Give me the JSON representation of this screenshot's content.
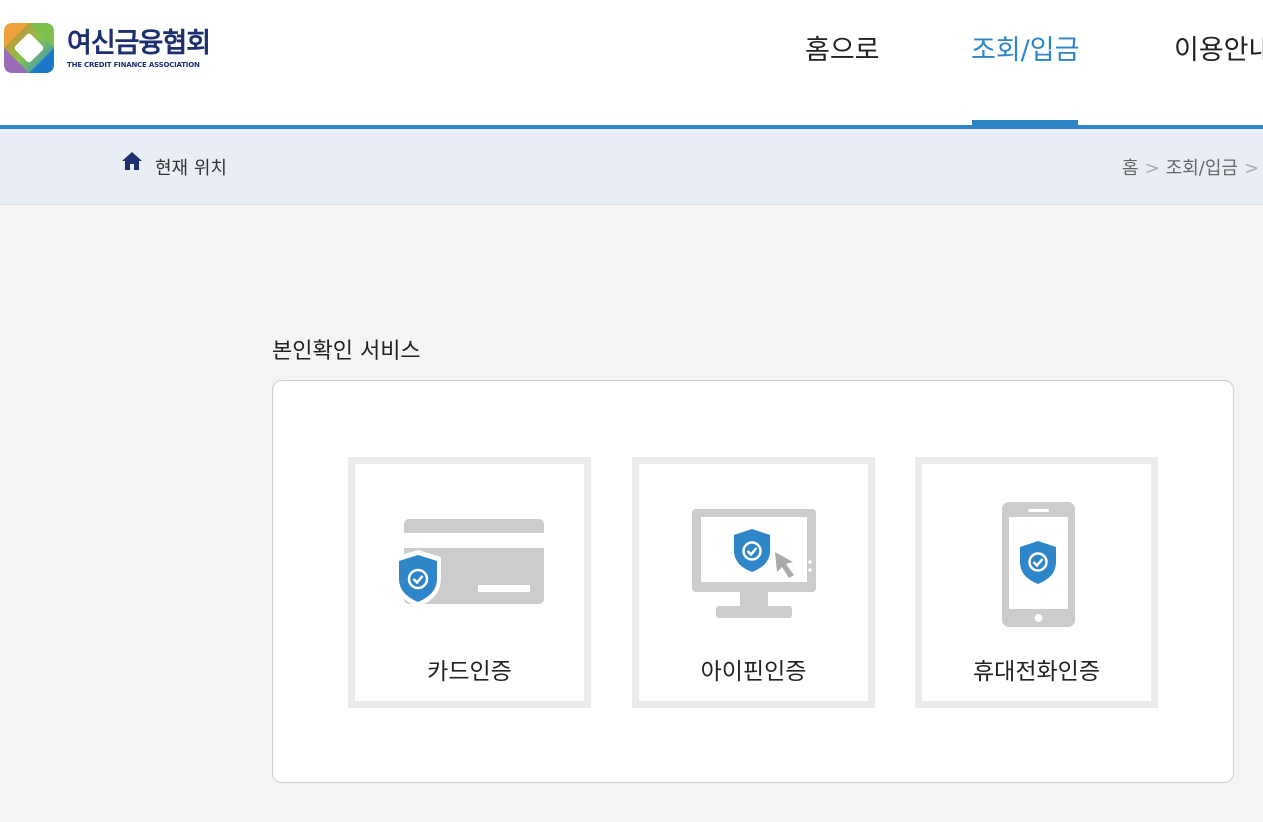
{
  "header": {
    "logo": {
      "name_ko": "여신금융협회",
      "name_en": "THE CREDIT FINANCE ASSOCIATION",
      "icon": "logo-icon"
    },
    "nav": [
      {
        "label": "홈으로",
        "active": false
      },
      {
        "label": "조회/입금",
        "active": true
      },
      {
        "label": "이용안내",
        "active": false
      }
    ],
    "accent_color": "#2e86c8"
  },
  "breadcrumb": {
    "icon": "home-icon",
    "title": "현재 위치",
    "path": [
      "홈",
      "조회/입금"
    ],
    "separator": ">"
  },
  "section": {
    "title": "본인확인 서비스",
    "options": [
      {
        "label": "카드인증",
        "icon": "credit-card-shield-icon"
      },
      {
        "label": "아이핀인증",
        "icon": "monitor-shield-icon"
      },
      {
        "label": "휴대전화인증",
        "icon": "mobile-phone-shield-icon"
      }
    ]
  }
}
